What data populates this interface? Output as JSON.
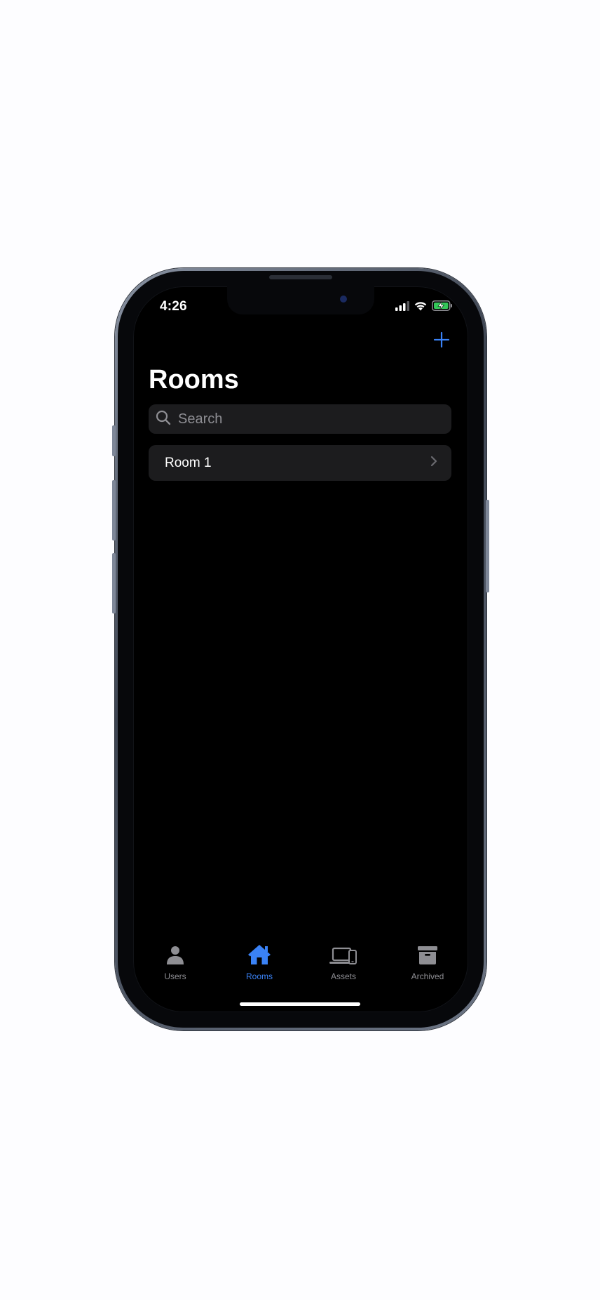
{
  "status_bar": {
    "time": "4:26",
    "icons": [
      "cellular-signal-icon",
      "wifi-icon",
      "battery-charging-icon"
    ]
  },
  "nav": {
    "add_icon": "plus-icon",
    "title": "Rooms"
  },
  "search": {
    "placeholder": "Search",
    "value": "",
    "icon": "search-icon"
  },
  "rooms": [
    {
      "label": "Room 1",
      "icon": "chevron-right-icon"
    }
  ],
  "tabs": [
    {
      "label": "Users",
      "icon": "person-icon",
      "active": false
    },
    {
      "label": "Rooms",
      "icon": "house-icon",
      "active": true
    },
    {
      "label": "Assets",
      "icon": "laptop-phone-icon",
      "active": false
    },
    {
      "label": "Archived",
      "icon": "archive-box-icon",
      "active": false
    }
  ],
  "colors": {
    "accent": "#3a82f6",
    "background": "#000000",
    "cell": "#1c1c1e",
    "inactive": "#8e8e93"
  }
}
